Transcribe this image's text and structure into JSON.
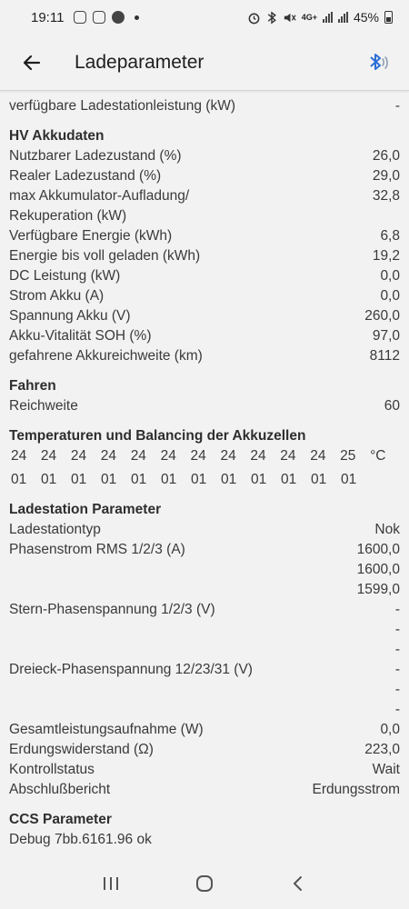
{
  "status_bar": {
    "time": "19:11",
    "network": "4G+",
    "battery": "45%"
  },
  "header": {
    "title": "Ladeparameter",
    "back_icon": "arrow-left-icon",
    "bluetooth_icon": "bluetooth-icon"
  },
  "top_row": {
    "label": "verfügbare Ladestationleistung (kW)",
    "value": "-"
  },
  "hv": {
    "title": "HV Akkudaten",
    "rows": [
      {
        "label": "Nutzbarer Ladezustand (%)",
        "value": "26,0"
      },
      {
        "label": "Realer Ladezustand (%)",
        "value": "29,0"
      },
      {
        "label": "max Akkumulator-Aufladung/ Rekuperation (kW)",
        "value": "32,8"
      },
      {
        "label": "Verfügbare Energie (kWh)",
        "value": "6,8"
      },
      {
        "label": "Energie bis voll geladen (kWh)",
        "value": "19,2"
      },
      {
        "label": "DC Leistung (kW)",
        "value": "0,0"
      },
      {
        "label": "Strom Akku (A)",
        "value": "0,0"
      },
      {
        "label": "Spannung Akku (V)",
        "value": "260,0"
      },
      {
        "label": "Akku-Vitalität SOH (%)",
        "value": "97,0"
      },
      {
        "label": "gefahrene Akkureichweite (km)",
        "value": "8112"
      }
    ]
  },
  "fahren": {
    "title": "Fahren",
    "rows": [
      {
        "label": "Reichweite",
        "value": "60"
      }
    ]
  },
  "temps": {
    "title": "Temperaturen und Balancing der Akkuzellen",
    "temps": [
      "24",
      "24",
      "24",
      "24",
      "24",
      "24",
      "24",
      "24",
      "24",
      "24",
      "24",
      "25",
      "°C"
    ],
    "balancing": [
      "01",
      "01",
      "01",
      "01",
      "01",
      "01",
      "01",
      "01",
      "01",
      "01",
      "01",
      "01"
    ]
  },
  "ladestation": {
    "title": "Ladestation Parameter",
    "typ": {
      "label": "Ladestationtyp",
      "value": "Nok"
    },
    "phasenstrom": {
      "label": "Phasenstrom RMS 1/2/3 (A)",
      "values": [
        "1600,0",
        "1600,0",
        "1599,0"
      ]
    },
    "stern": {
      "label": "Stern-Phasenspannung 1/2/3 (V)",
      "values": [
        "-",
        "-",
        "-"
      ]
    },
    "dreieck": {
      "label": "Dreieck-Phasenspannung 12/23/31 (V)",
      "values": [
        "-",
        "-",
        "-"
      ]
    },
    "rows": [
      {
        "label": "Gesamtleistungsaufnahme (W)",
        "value": "0,0"
      },
      {
        "label": "Erdungswiderstand (Ω)",
        "value": "223,0"
      },
      {
        "label": "Kontrollstatus",
        "value": "Wait"
      },
      {
        "label": "Abschlußbericht",
        "value": "Erdungsstrom"
      }
    ]
  },
  "ccs": {
    "title": "CCS Parameter",
    "debug": "Debug 7bb.6161.96 ok"
  },
  "navbar": {
    "recents_icon": "recents-icon",
    "home_icon": "home-icon",
    "back_icon": "nav-back-icon"
  },
  "colors": {
    "background": "#f2f2f2",
    "text": "#3a3a3a",
    "bluetooth_accent": "#2b6fd6"
  }
}
